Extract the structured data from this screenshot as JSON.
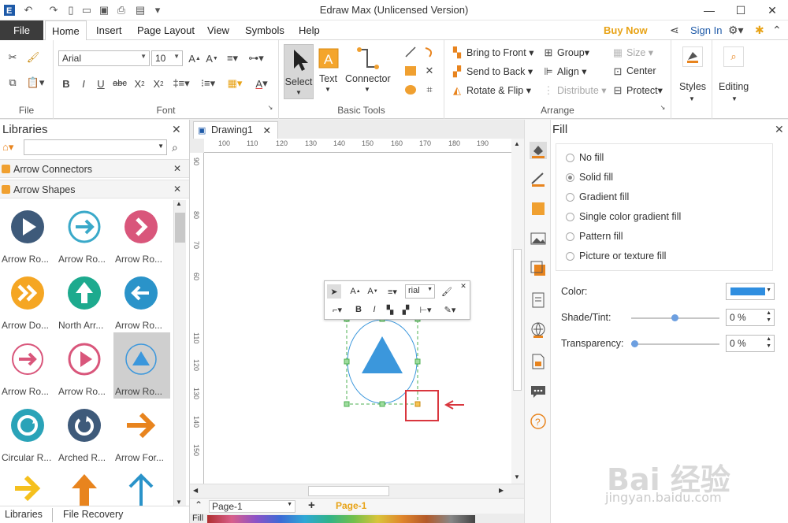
{
  "app": {
    "title": "Edraw Max (Unlicensed Version)"
  },
  "menu": {
    "file": "File",
    "tabs": [
      "Home",
      "Insert",
      "Page Layout",
      "View",
      "Symbols",
      "Help"
    ],
    "buy_now": "Buy Now",
    "sign_in": "Sign In"
  },
  "ribbon": {
    "file_group": "File",
    "font_group": "Font",
    "font_name": "Arial",
    "font_size": "10",
    "basic_tools_group": "Basic Tools",
    "select": "Select",
    "text": "Text",
    "connector": "Connector",
    "arrange_group": "Arrange",
    "bring_to_front": "Bring to Front",
    "send_to_back": "Send to Back",
    "rotate_flip": "Rotate & Flip",
    "group": "Group",
    "align": "Align",
    "distribute": "Distribute",
    "size": "Size",
    "center": "Center",
    "protect": "Protect",
    "styles": "Styles",
    "editing": "Editing"
  },
  "libraries": {
    "title": "Libraries",
    "search_value": "",
    "sections": [
      "Arrow Connectors",
      "Arrow Shapes"
    ],
    "shapes": [
      {
        "label": "Arrow Ro...",
        "icon": "play-circle-icon"
      },
      {
        "label": "Arrow Ro...",
        "icon": "arrow-right-circle-icon"
      },
      {
        "label": "Arrow Ro...",
        "icon": "chevron-right-circle-icon"
      },
      {
        "label": "Arrow Do...",
        "icon": "double-chevron-circle-icon"
      },
      {
        "label": "North Arr...",
        "icon": "arrow-up-circle-icon"
      },
      {
        "label": "Arrow Ro...",
        "icon": "arrow-left-circle-icon"
      },
      {
        "label": "Arrow Ro...",
        "icon": "arrow-right-outline-circle-icon"
      },
      {
        "label": "Arrow Ro...",
        "icon": "play-outline-circle-icon"
      },
      {
        "label": "Arrow Ro...",
        "icon": "triangle-up-circle-icon"
      },
      {
        "label": "Circular R...",
        "icon": "circular-arrow-icon"
      },
      {
        "label": "Arched R...",
        "icon": "arched-arrow-icon"
      },
      {
        "label": "Arrow For...",
        "icon": "arrow-forward-icon"
      },
      {
        "label": "",
        "icon": "arrow-right-bold-icon"
      },
      {
        "label": "",
        "icon": "arrow-up-bold-icon"
      },
      {
        "label": "",
        "icon": "arrow-up-thin-icon"
      }
    ],
    "bottom_tabs": [
      "Libraries",
      "File Recovery"
    ]
  },
  "document": {
    "tab": "Drawing1",
    "ruler_h": [
      "100",
      "110",
      "120",
      "130",
      "140",
      "150",
      "160",
      "170",
      "180",
      "190"
    ],
    "ruler_v": [
      "90",
      "80",
      "70",
      "60",
      "110",
      "120",
      "130",
      "140",
      "150"
    ],
    "page_selector": "Page-1",
    "page_tab": "Page-1",
    "fill_label": "Fill",
    "float_font": "rial"
  },
  "fill": {
    "title": "Fill",
    "options": [
      "No fill",
      "Solid fill",
      "Gradient fill",
      "Single color gradient fill",
      "Pattern fill",
      "Picture or texture fill"
    ],
    "selected": "Solid fill",
    "color_label": "Color:",
    "color_value": "#2f8ee0",
    "shade_label": "Shade/Tint:",
    "shade_value": "0 %",
    "transparency_label": "Transparency:",
    "transparency_value": "0 %"
  },
  "colors": {
    "accent": "#f0a030",
    "shape_blue": "#3b97dc",
    "selection_green": "#4caf50",
    "highlight_red": "#d9363e"
  },
  "watermark": {
    "main": "Bai 经验",
    "sub": "jingyan.baidu.com"
  }
}
